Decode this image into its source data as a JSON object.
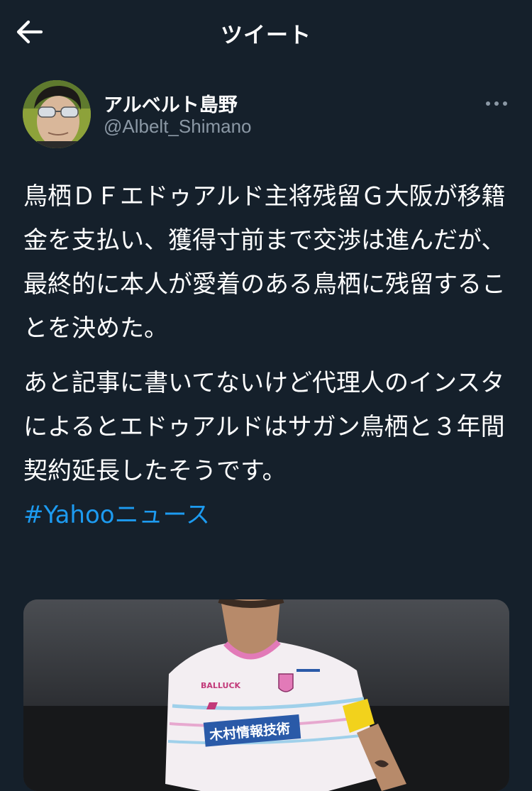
{
  "header": {
    "title": "ツイート",
    "back_icon": "back-arrow-icon"
  },
  "author": {
    "display_name": "アルベルト島野",
    "handle": "@Albelt_Shimano"
  },
  "more_icon": "more-horizontal-icon",
  "tweet": {
    "paragraph1": "鳥栖ＤＦエドゥアルド主将残留Ｇ大阪が移籍金を支払い、獲得寸前まで交渉は進んだが、最終的に本人が愛着のある鳥栖に残留することを決めた。",
    "paragraph2": "あと記事に書いてないけど代理人のインスタによるとエドゥアルドはサガン鳥栖と３年間契約延長したそうです。",
    "hashtag": "#Yahooニュース"
  },
  "media": {
    "jersey_sponsor": "木村情報技術",
    "jersey_chest": "BALLUCK"
  },
  "colors": {
    "background": "#15202b",
    "link": "#1d9bf0",
    "secondary_text": "#8b98a5"
  }
}
